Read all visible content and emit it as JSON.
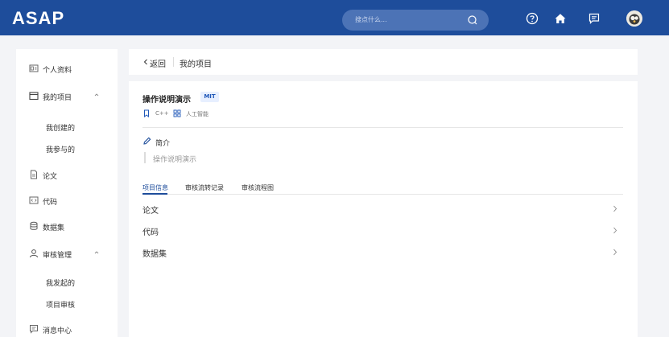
{
  "header": {
    "logo": "ASAP",
    "search_placeholder": "搜点什么...",
    "icons": [
      "search-icon",
      "help-icon",
      "home-icon",
      "message-icon"
    ],
    "accent_color": "#1e4d9b"
  },
  "sidebar": {
    "items": [
      {
        "label": "个人资料",
        "icon": "profile-card-icon"
      },
      {
        "label": "我的项目",
        "icon": "folder-icon",
        "expanded": true
      },
      {
        "label": "我创建的"
      },
      {
        "label": "我参与的"
      },
      {
        "label": "论文",
        "icon": "document-icon"
      },
      {
        "label": "代码",
        "icon": "code-icon"
      },
      {
        "label": "数据集",
        "icon": "database-icon"
      },
      {
        "label": "审核管理",
        "icon": "user-review-icon",
        "expanded": true
      },
      {
        "label": "我发起的"
      },
      {
        "label": "项目审核"
      },
      {
        "label": "消息中心",
        "icon": "message-icon"
      }
    ]
  },
  "breadcrumb": {
    "back_label": "返回",
    "current": "我的项目"
  },
  "project": {
    "title": "操作说明演示",
    "license": "MIT",
    "tags": [
      {
        "label": "C++",
        "icon": "bookmark-icon"
      },
      {
        "label": "人工智能",
        "icon": "grid-icon"
      }
    ],
    "intro_label": "简介",
    "intro_text": "操作说明演示"
  },
  "tabs": [
    {
      "label": "项目信息",
      "active": true
    },
    {
      "label": "审核流转记录",
      "active": false
    },
    {
      "label": "审核流程图",
      "active": false
    }
  ],
  "rows": [
    {
      "label": "论文"
    },
    {
      "label": "代码"
    },
    {
      "label": "数据集"
    }
  ]
}
